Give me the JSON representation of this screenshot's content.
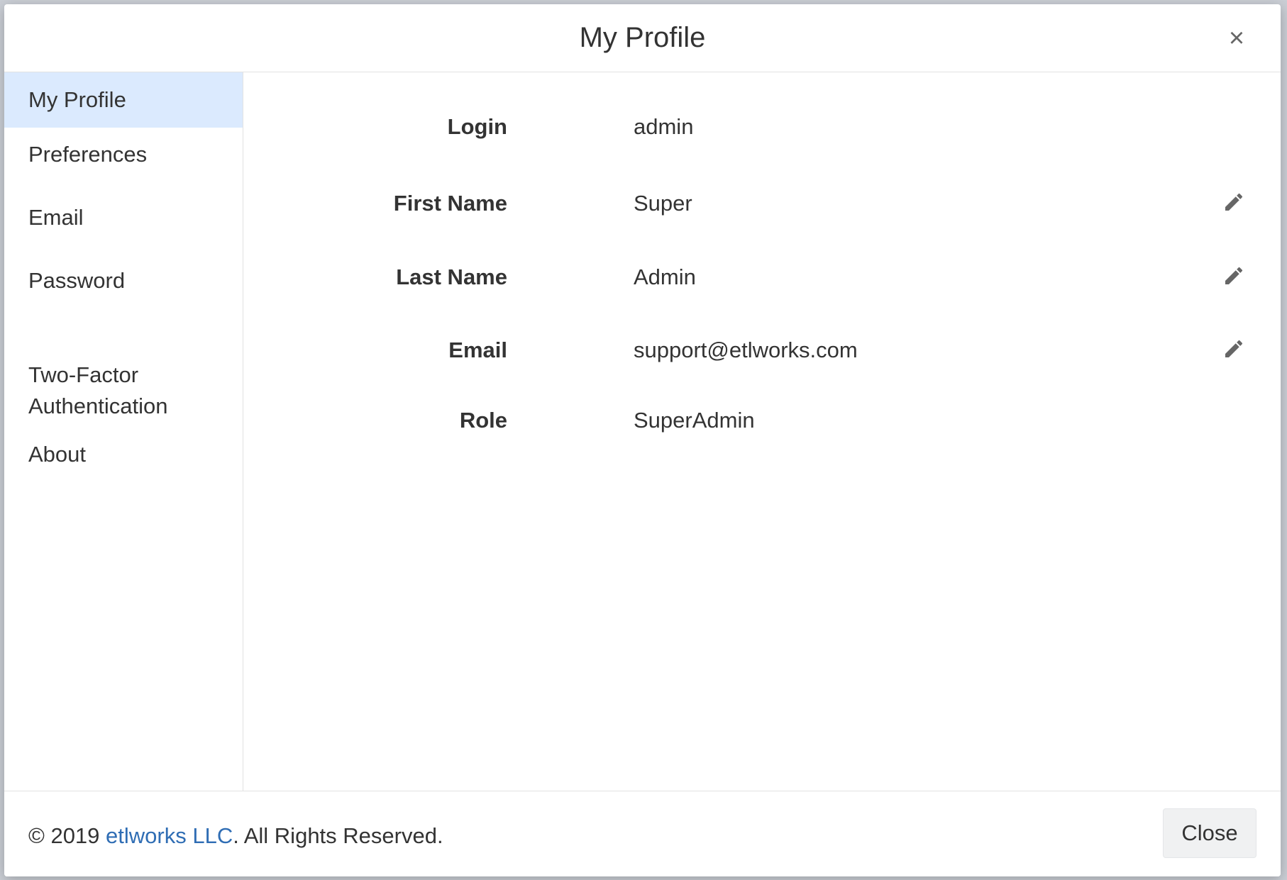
{
  "modal": {
    "title": "My Profile",
    "close_icon": "×"
  },
  "sidebar": {
    "items": [
      {
        "label": "My Profile",
        "active": true
      },
      {
        "label": "Preferences",
        "active": false
      },
      {
        "label": "Email",
        "active": false
      },
      {
        "label": "Password",
        "active": false
      },
      {
        "label": "Two-Factor\nAuthentication",
        "active": false
      },
      {
        "label": "About",
        "active": false
      }
    ]
  },
  "profile": {
    "fields": [
      {
        "label": "Login",
        "value": "admin",
        "editable": false
      },
      {
        "label": "First Name",
        "value": "Super",
        "editable": true
      },
      {
        "label": "Last Name",
        "value": "Admin",
        "editable": true
      },
      {
        "label": "Email",
        "value": "support@etlworks.com",
        "editable": true
      },
      {
        "label": "Role",
        "value": "SuperAdmin",
        "editable": false
      }
    ]
  },
  "footer": {
    "copyright_prefix": "© 2019 ",
    "company_link": "etlworks LLC",
    "copyright_suffix": ". All Rights Reserved.",
    "close_label": "Close"
  },
  "colors": {
    "active_nav_bg": "#dbeafe",
    "link": "#2f6db4",
    "text": "#333333",
    "icon": "#666666"
  }
}
